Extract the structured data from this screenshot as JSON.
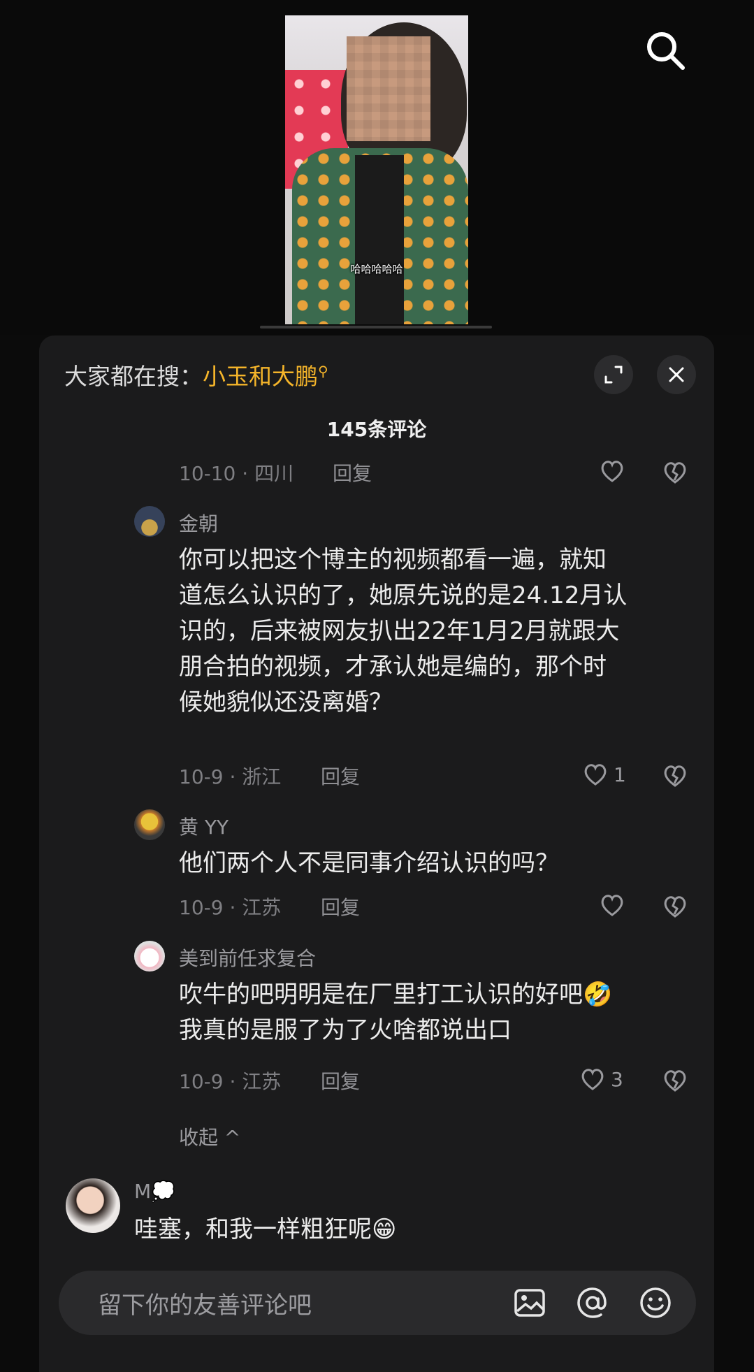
{
  "video": {
    "caption": "哈哈哈哈哈"
  },
  "panel": {
    "hot_search": {
      "prefix": "大家都在搜：",
      "keyword": "小玉和大鹏"
    },
    "comment_count": "145条评论"
  },
  "comments": [
    {
      "meta": "10-10 · 四川",
      "reply_label": "回复",
      "likes": ""
    },
    {
      "user": "金朝",
      "text_lines": [
        "你可以把这个博主的视频都看一遍，就知",
        "道怎么认识的了，她原先说的是24.12月认",
        "识的，后来被网友扒出22年1月2月就跟大",
        "朋合拍的视频，才承认她是编的，那个时",
        "候她貌似还没离婚？"
      ],
      "meta": "10-9 · 浙江",
      "reply_label": "回复",
      "likes": "1"
    },
    {
      "user": "黄 YY",
      "text_lines": [
        "他们两个人不是同事介绍认识的吗？"
      ],
      "meta": "10-9 · 江苏",
      "reply_label": "回复",
      "likes": ""
    },
    {
      "user": "美到前任求复合",
      "text_lines": [
        "吹牛的吧明明是在厂里打工认识的好吧🤣",
        "我真的是服了为了火啥都说出口"
      ],
      "meta": "10-9 · 江苏",
      "reply_label": "回复",
      "likes": "3"
    }
  ],
  "collapse_label": "收起 ^",
  "next_comment": {
    "user": "M💭",
    "text": "哇塞，和我一样粗狂呢😁"
  },
  "input": {
    "placeholder": "留下你的友善评论吧"
  },
  "icons": [
    "search-icon",
    "expand-icon",
    "close-icon",
    "heart-icon",
    "broken-heart-icon",
    "image-icon",
    "at-icon",
    "emoji-icon"
  ]
}
